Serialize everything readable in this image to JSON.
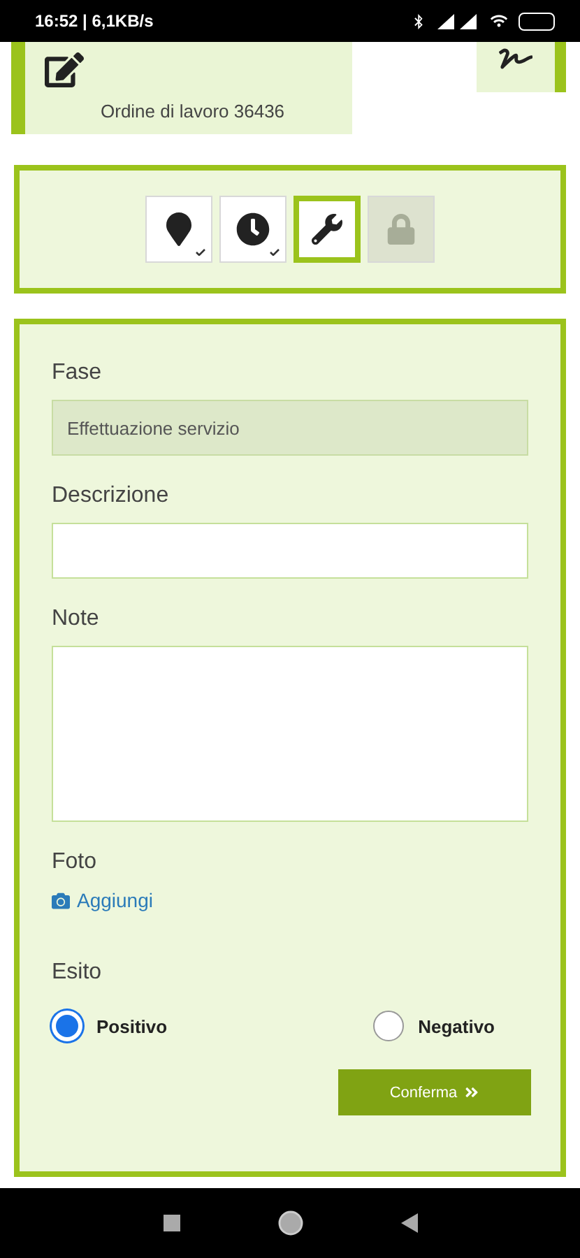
{
  "status_bar": {
    "text": "16:52 | 6,1KB/s"
  },
  "header": {
    "order": "Ordine di lavoro 36436"
  },
  "steps": [
    {
      "kind": "pin",
      "done": true,
      "selected": false,
      "disabled": false
    },
    {
      "kind": "clock",
      "done": true,
      "selected": false,
      "disabled": false
    },
    {
      "kind": "wrench",
      "done": false,
      "selected": true,
      "disabled": false
    },
    {
      "kind": "lock",
      "done": false,
      "selected": false,
      "disabled": true
    }
  ],
  "form": {
    "fields": [
      {
        "kind": "readonly",
        "label": "Fase",
        "value": "Effettuazione servizio"
      },
      {
        "kind": "input",
        "label": "Descrizione"
      },
      {
        "kind": "textarea",
        "label": "Note"
      }
    ],
    "photo": {
      "label": "Foto",
      "link": "Aggiungi"
    },
    "outcome": {
      "label": "Esito",
      "options": [
        {
          "label": "Positivo",
          "selected": true
        },
        {
          "label": "Negativo",
          "selected": false
        }
      ]
    },
    "submit": "Conferma"
  }
}
